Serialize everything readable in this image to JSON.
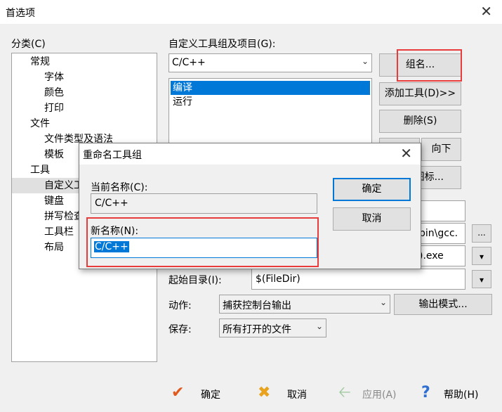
{
  "window": {
    "title": "首选项",
    "close_glyph": "✕"
  },
  "category": {
    "label": "分类(C)",
    "items": [
      {
        "label": "常规",
        "level": 0
      },
      {
        "label": "字体",
        "level": 1
      },
      {
        "label": "颜色",
        "level": 1
      },
      {
        "label": "打印",
        "level": 1
      },
      {
        "label": "文件",
        "level": 0
      },
      {
        "label": "文件类型及语法",
        "level": 1
      },
      {
        "label": "模板",
        "level": 1
      },
      {
        "label": "工具",
        "level": 0
      },
      {
        "label": "自定义工",
        "level": 1
      },
      {
        "label": "键盘",
        "level": 1
      },
      {
        "label": "拼写检查",
        "level": 1
      },
      {
        "label": "工具栏",
        "level": 1
      },
      {
        "label": "布局",
        "level": 1
      }
    ]
  },
  "tools": {
    "group_label": "自定义工具组及项目(G):",
    "group_value": "C/C++",
    "list_items": [
      "编译",
      "运行"
    ],
    "group_name_btn": "组名...",
    "add_tool_btn": "添加工具(D)>>",
    "delete_btn": "删除(S)",
    "down_btn": "向下",
    "icon_btn": "图标...",
    "command_partial": "bin\\gcc.",
    "param_partial": ").exe",
    "browse_btn": "...",
    "start_dir_label": "起始目录(I):",
    "start_dir_value": "$(FileDir)",
    "action_label": "动作:",
    "action_value": "捕获控制台输出",
    "output_mode_btn": "输出模式...",
    "save_label": "保存:",
    "save_value": "所有打开的文件"
  },
  "rename_dialog": {
    "title": "重命名工具组",
    "current_label": "当前名称(C):",
    "current_value": "C/C++",
    "new_label": "新名称(N):",
    "new_value": "C/C++",
    "ok_btn": "确定",
    "cancel_btn": "取消"
  },
  "footer": {
    "ok": "确定",
    "cancel": "取消",
    "apply": "应用(A)",
    "help": "帮助(H)"
  },
  "colors": {
    "highlight": "#e83c3c",
    "selection": "#0078d7",
    "ok_icon": "#e05a1e",
    "cancel_icon": "#e8a21e",
    "apply_icon": "#9ec79e",
    "help_icon": "#2f6fd0"
  },
  "icons": {
    "ok": "checkmark-icon",
    "cancel": "x-icon",
    "apply": "left-arrow-icon",
    "help": "question-icon"
  }
}
